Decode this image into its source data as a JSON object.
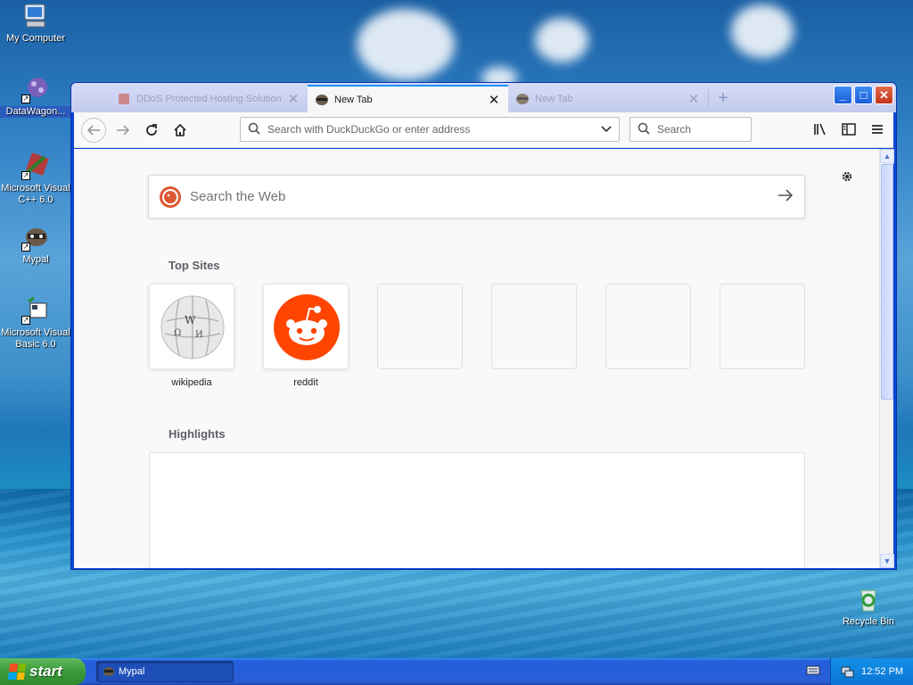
{
  "desktop": {
    "icons": [
      {
        "label": "My Computer",
        "icon": "my-computer-icon"
      },
      {
        "label": "DataWagon...",
        "icon": "datawagon-icon"
      },
      {
        "label": "Microsoft Visual C++ 6.0",
        "icon": "visual-cpp-icon"
      },
      {
        "label": "Mypal",
        "icon": "mypal-icon"
      },
      {
        "label": "Microsoft Visual Basic 6.0",
        "icon": "visual-basic-icon"
      },
      {
        "label": "Recycle Bin",
        "icon": "recycle-bin-icon"
      }
    ]
  },
  "browser": {
    "tabs": [
      {
        "title": "DDoS Protected Hosting Solutions",
        "state": "inactive"
      },
      {
        "title": "New Tab",
        "state": "active"
      },
      {
        "title": "New Tab",
        "state": "inactive"
      }
    ],
    "urlbar": {
      "placeholder": "Search with DuckDuckGo or enter address"
    },
    "searchbar": {
      "placeholder": "Search"
    },
    "newtab": {
      "search_placeholder": "Search the Web",
      "top_sites_title": "Top Sites",
      "top_sites": [
        {
          "label": "wikipedia"
        },
        {
          "label": "reddit"
        }
      ],
      "highlights_title": "Highlights"
    }
  },
  "taskbar": {
    "start_label": "start",
    "task_item": "Mypal",
    "clock": "12:52 PM"
  },
  "colors": {
    "xp_blue": "#0a46d8",
    "active_tab_accent": "#1e90ff",
    "reddit": "#ff4500",
    "duckduckgo": "#de5833",
    "start_green": "#3c9a3b"
  }
}
